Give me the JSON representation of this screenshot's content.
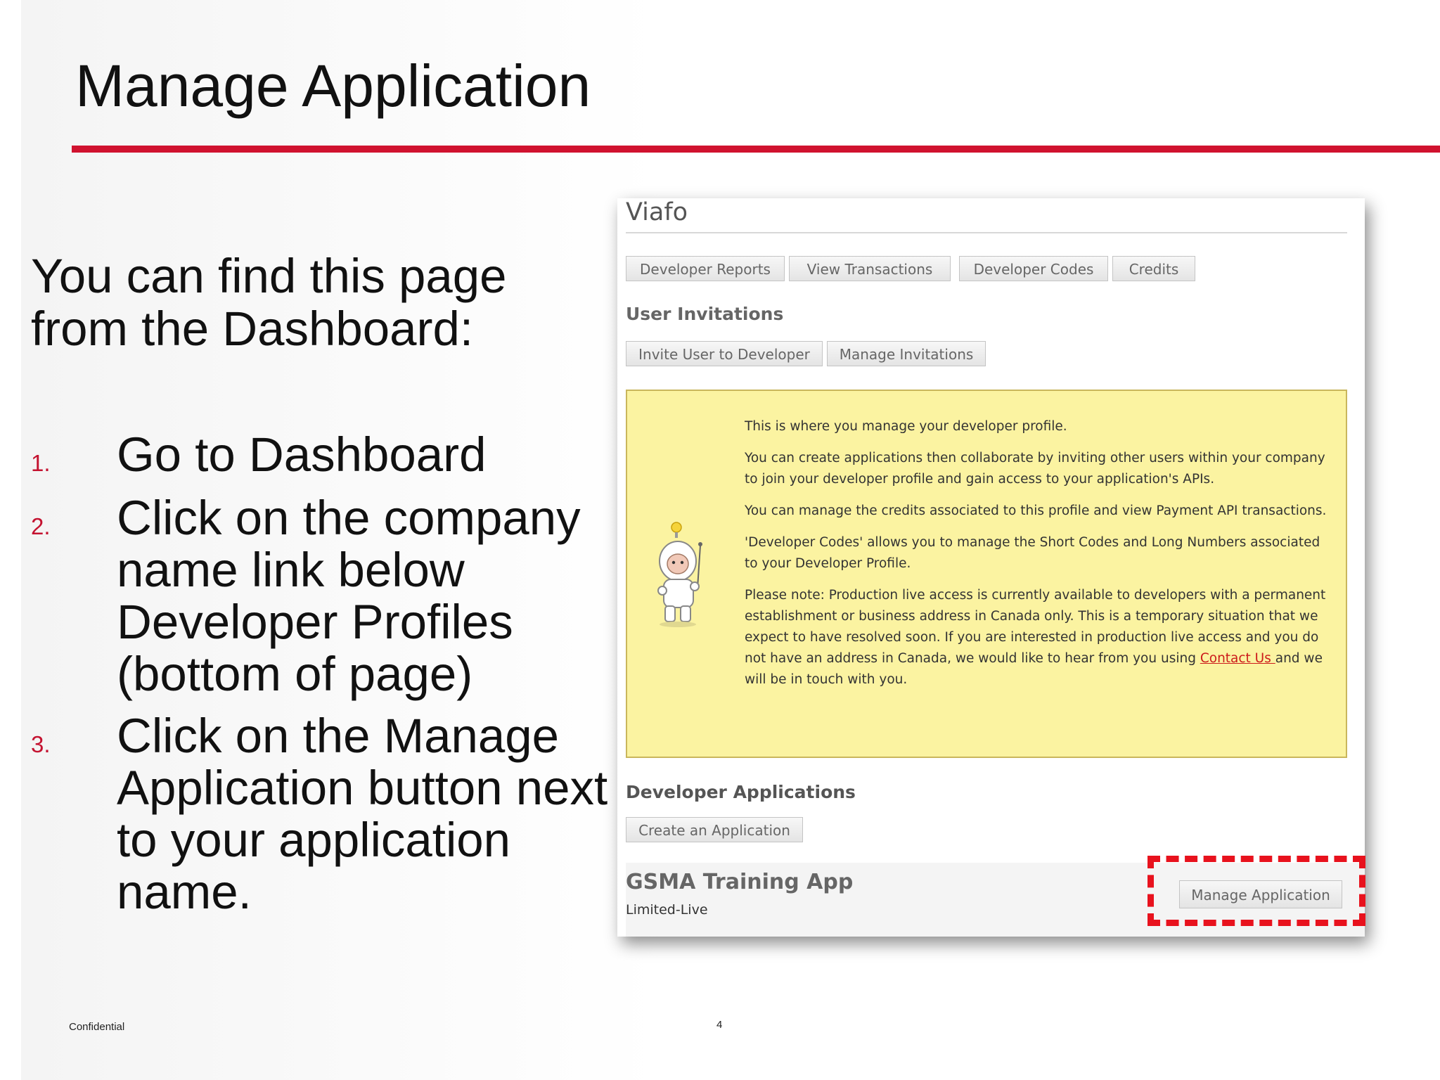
{
  "slide": {
    "title": "Manage Application",
    "intro": "You can find this page from the Dashboard:",
    "steps": [
      {
        "num": "1.",
        "text": "Go to Dashboard"
      },
      {
        "num": "2.",
        "text": "Click on the company name link below Developer Profiles (bottom of page)"
      },
      {
        "num": "3.",
        "text": "Click on the Manage Application button next to your application name."
      }
    ],
    "footer_left": "Confidential",
    "page_number": "4",
    "accent_color": "#d0122f"
  },
  "screenshot": {
    "org_name": "Viafo",
    "nav_buttons": [
      "Developer Reports",
      "View Transactions",
      "Developer Codes",
      "Credits"
    ],
    "user_invitations": {
      "heading": "User Invitations",
      "buttons": [
        "Invite User to Developer",
        "Manage Invitations"
      ]
    },
    "info_box": {
      "p1": "This is where you manage your developer profile.",
      "p2": "You can create applications then collaborate by inviting other users within your company to join your developer profile and gain access to your application's APIs.",
      "p3": "You can manage the credits associated to this profile and view Payment API transactions.",
      "p4": "'Developer Codes' allows you to manage the Short Codes and Long Numbers associated to your Developer Profile.",
      "p5_before": "Please note: Production live access is currently available to developers with a permanent establishment or business address in Canada only.  This is a temporary situation that we expect to have resolved soon. If you are interested in production live access and you do not have an address in Canada, we would like to hear from you using ",
      "p5_link": "Contact Us ",
      "p5_after": "and we will be in touch with you.",
      "background_color": "#fbf3a1"
    },
    "developer_applications": {
      "heading": "Developer Applications",
      "create_button": "Create an Application"
    },
    "app": {
      "name": "GSMA Training App",
      "status": "Limited-Live",
      "manage_button": "Manage Application"
    },
    "highlight_color": "#e8121d"
  }
}
